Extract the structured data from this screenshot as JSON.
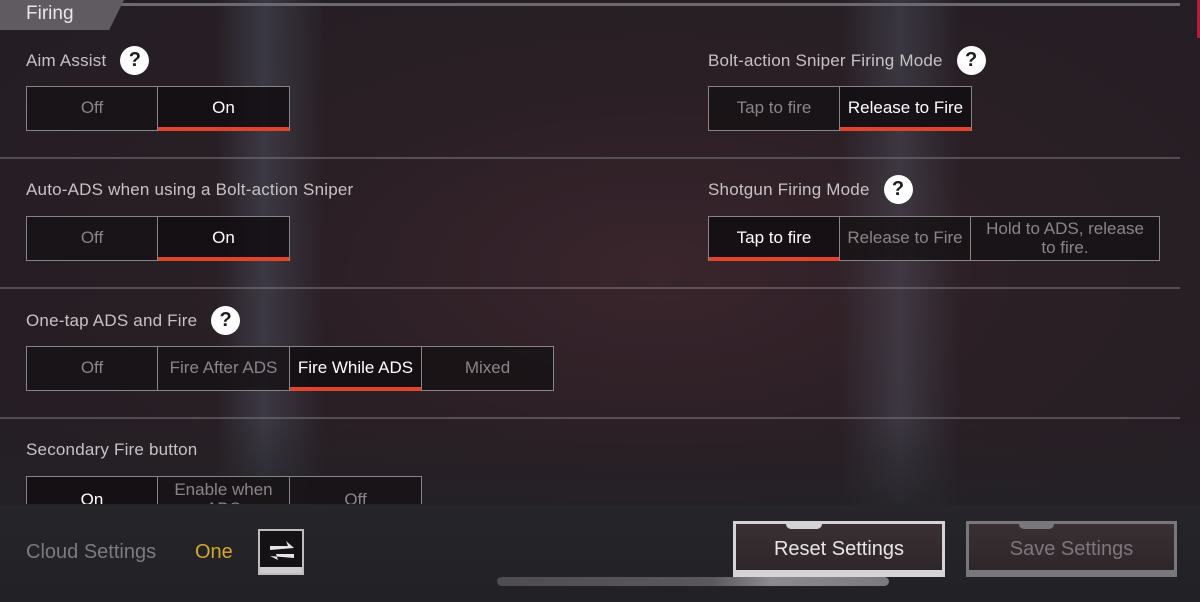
{
  "section": {
    "title": "Firing"
  },
  "settings": {
    "aim_assist": {
      "label": "Aim Assist",
      "has_help": true,
      "options": [
        "Off",
        "On"
      ],
      "selected": "On"
    },
    "bolt_sniper_mode": {
      "label": "Bolt-action Sniper Firing Mode",
      "has_help": true,
      "options": [
        "Tap to fire",
        "Release to Fire"
      ],
      "selected": "Release to Fire"
    },
    "auto_ads": {
      "label": "Auto-ADS when using a Bolt-action Sniper",
      "has_help": false,
      "options": [
        "Off",
        "On"
      ],
      "selected": "On"
    },
    "shotgun_mode": {
      "label": "Shotgun Firing Mode",
      "has_help": true,
      "options": [
        "Tap to fire",
        "Release to Fire",
        "Hold to ADS, release to fire."
      ],
      "selected": "Tap to fire"
    },
    "one_tap_ads": {
      "label": "One-tap ADS and Fire",
      "has_help": true,
      "options": [
        "Off",
        "Fire After ADS",
        "Fire While ADS",
        "Mixed"
      ],
      "selected": "Fire While ADS"
    },
    "secondary_fire": {
      "label": "Secondary Fire button",
      "has_help": false,
      "options": [
        "On",
        "Enable when ADS",
        "Off"
      ],
      "selected": "On"
    }
  },
  "help_glyph": "?",
  "footer": {
    "cloud_label": "Cloud Settings",
    "cloud_value": "One",
    "swap_icon": "swap-arrows-icon",
    "reset_label": "Reset Settings",
    "save_label": "Save Settings"
  },
  "colors": {
    "accent": "#e2442b",
    "cloud_value": "#d4a72c",
    "scrollbar": "#c4143a"
  }
}
